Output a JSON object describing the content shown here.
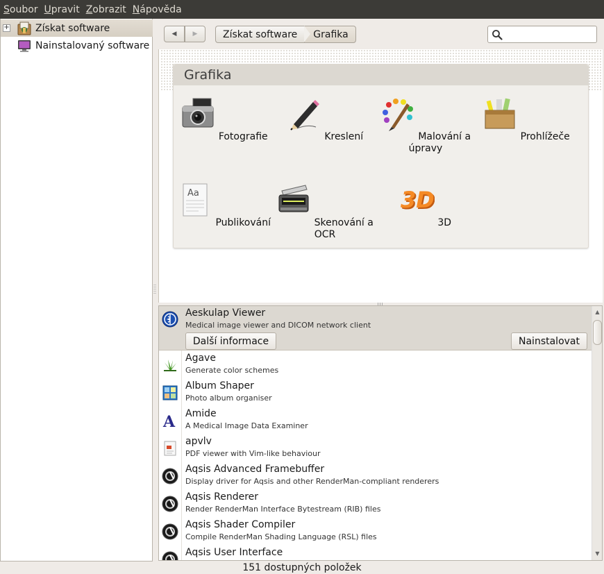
{
  "menu": [
    {
      "accel": "S",
      "rest": "oubor"
    },
    {
      "accel": "U",
      "rest": "pravit"
    },
    {
      "accel": "Z",
      "rest": "obrazit"
    },
    {
      "accel": "N",
      "rest": "ápověda"
    }
  ],
  "sidebar": {
    "items": [
      {
        "label": "Získat software",
        "icon": "software-center-icon",
        "selected": true,
        "expander": "+"
      },
      {
        "label": "Nainstalovaný software",
        "icon": "monitor-icon",
        "selected": false
      }
    ]
  },
  "toolbar": {
    "back": "◀",
    "forward": "▶",
    "breadcrumbs": [
      "Získat software",
      "Grafika"
    ],
    "search": {
      "value": "",
      "placeholder": ""
    }
  },
  "category": {
    "title": "Grafika",
    "items": [
      {
        "label": "Fotografie",
        "icon": "camera-icon"
      },
      {
        "label": "Kreslení",
        "icon": "pencil-icon"
      },
      {
        "label": "Malování a\núpravy",
        "icon": "paint-palette-icon"
      },
      {
        "label": "Prohlížeče",
        "icon": "viewer-box-icon"
      },
      {
        "label": "Publikování",
        "icon": "document-icon"
      },
      {
        "label": "Skenování a OCR",
        "icon": "scanner-icon"
      },
      {
        "label": "3D",
        "icon": "3d-icon"
      }
    ]
  },
  "apps": [
    {
      "name": "Aeskulap Viewer",
      "desc": "Medical image viewer and DICOM network client",
      "icon": "aeskulap-icon",
      "selected": true
    },
    {
      "name": "Agave",
      "desc": "Generate color schemes",
      "icon": "agave-icon"
    },
    {
      "name": "Album Shaper",
      "desc": "Photo album organiser",
      "icon": "album-shaper-icon"
    },
    {
      "name": "Amide",
      "desc": "A Medical Image Data Examiner",
      "icon": "amide-icon"
    },
    {
      "name": "apvlv",
      "desc": "PDF viewer with Vim-like behaviour",
      "icon": "apvlv-icon"
    },
    {
      "name": "Aqsis Advanced Framebuffer",
      "desc": "Display driver for Aqsis and other RenderMan-compliant renderers",
      "icon": "aqsis-icon"
    },
    {
      "name": "Aqsis Renderer",
      "desc": "Render RenderMan Interface Bytestream (RIB) files",
      "icon": "aqsis-icon"
    },
    {
      "name": "Aqsis Shader Compiler",
      "desc": "Compile RenderMan Shading Language (RSL) files",
      "icon": "aqsis-icon"
    },
    {
      "name": "Aqsis User Interface",
      "desc": "",
      "icon": "aqsis-icon"
    }
  ],
  "actions": {
    "more_info": "Další informace",
    "install": "Nainstalovat"
  },
  "status": "151 dostupných položek"
}
